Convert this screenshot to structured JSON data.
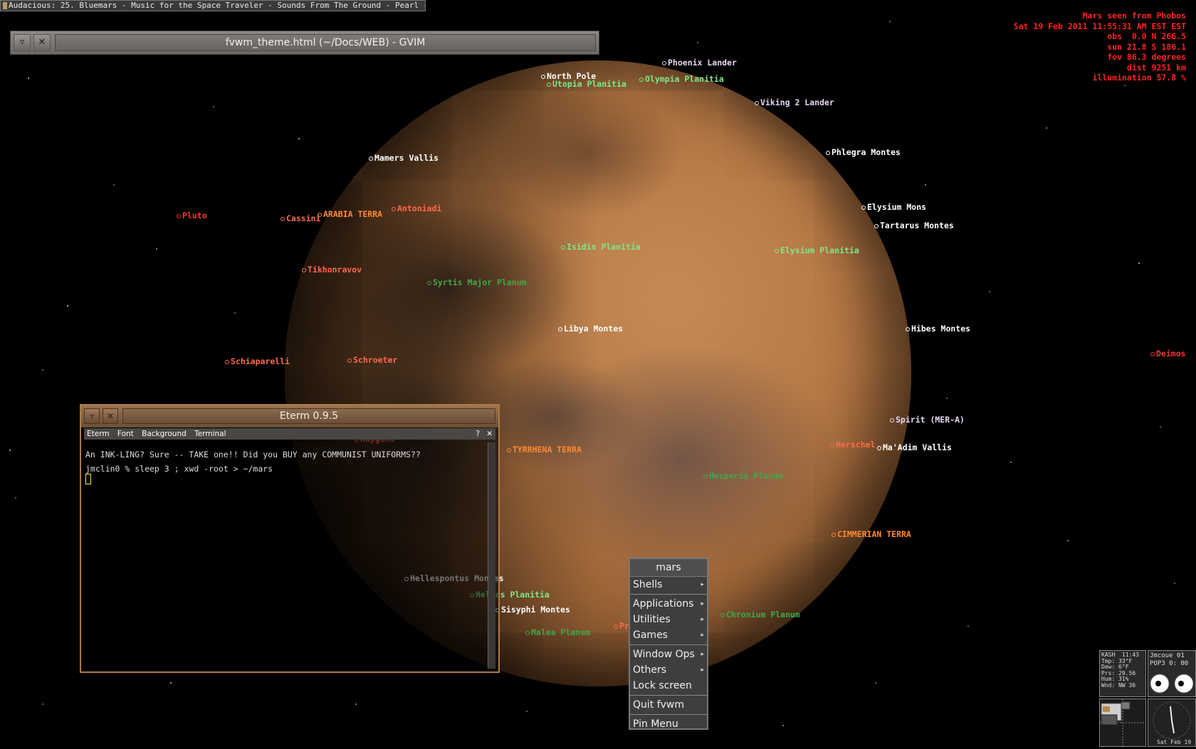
{
  "audacious_bar": {
    "text": "Audacious: 25. Bluemars - Music for the Space Traveler - Sounds From The Ground - Pearl - Audacio"
  },
  "gvim": {
    "title": "fvwm_theme.html (~/Docs/WEB) - GVIM"
  },
  "info": {
    "line1": "Mars seen from Phobos",
    "line2": "Sat 19 Feb 2011 11:55:31 AM EST EST",
    "line3": "obs  0.0 N 266.5",
    "line4": "sun 21.8 S 186.1",
    "line5": "fov 86.3 degrees",
    "line6": "dist 9251 km",
    "line7": "illumination 57.8 %"
  },
  "labels": [
    {
      "text": "Phoenix Lander",
      "color": "#e6d6f2"
    },
    {
      "text": "North Pole",
      "color": "#ffffff"
    },
    {
      "text": "Olympia Planitia",
      "color": "#7fe88a"
    },
    {
      "text": "Utopia Planitia",
      "color": "#7fe88a"
    },
    {
      "text": "Viking 2 Lander",
      "color": "#e6d6f2"
    },
    {
      "text": "Mamers Vallis",
      "color": "#ffffff"
    },
    {
      "text": "Phlegra Montes",
      "color": "#ffffff"
    },
    {
      "text": "Pluto",
      "color": "#ff3030"
    },
    {
      "text": "Cassini",
      "color": "#ff6a4a"
    },
    {
      "text": "ARABIA TERRA",
      "color": "#ff8a30"
    },
    {
      "text": "Antoniadi",
      "color": "#ff6a4a"
    },
    {
      "text": "Elysium Mons",
      "color": "#ffffff"
    },
    {
      "text": "Tartarus Montes",
      "color": "#ffffff"
    },
    {
      "text": "Isidis Planitia",
      "color": "#7fe88a"
    },
    {
      "text": "Elysium Planitia",
      "color": "#7fe88a"
    },
    {
      "text": "Tikhonravov",
      "color": "#ff6a4a"
    },
    {
      "text": "Syrtis Major Planum",
      "color": "#3fa84a"
    },
    {
      "text": "Libya Montes",
      "color": "#ffffff"
    },
    {
      "text": "Hibes Montes",
      "color": "#ffffff"
    },
    {
      "text": "Deimos",
      "color": "#ff3030"
    },
    {
      "text": "Schiaparelli",
      "color": "#ff6a4a"
    },
    {
      "text": "Schroeter",
      "color": "#ff6a4a"
    },
    {
      "text": "Spirit (MER-A)",
      "color": "#e6d6f2"
    },
    {
      "text": "Huygens",
      "color": "#ff6a4a"
    },
    {
      "text": "TYRRHENA TERRA",
      "color": "#ff8a30"
    },
    {
      "text": "Herschel",
      "color": "#ff6a4a"
    },
    {
      "text": "Ma'Adim Vallis",
      "color": "#ffffff"
    },
    {
      "text": "Hesperia Planum",
      "color": "#3fa84a"
    },
    {
      "text": "CIMMERIAN TERRA",
      "color": "#ff8a30"
    },
    {
      "text": "Hellespontus Montes",
      "color": "#ffffff"
    },
    {
      "text": "Hellas Planitia",
      "color": "#7fe88a"
    },
    {
      "text": "Sisyphi Montes",
      "color": "#ffffff"
    },
    {
      "text": "Chronium Planum",
      "color": "#3fa84a"
    },
    {
      "text": "Malea Planum",
      "color": "#3fa84a"
    },
    {
      "text": "Pr",
      "color": "#ff6a4a"
    }
  ],
  "eterm": {
    "title": "Eterm 0.9.5",
    "menu": [
      "Eterm",
      "Font",
      "Background",
      "Terminal"
    ],
    "help": "?",
    "close": "✕",
    "line1": "An INK-LING?  Sure -- TAKE one!!  Did you BUY any COMMUNIST UNIFORMS??",
    "line2": "jmclin0 % sleep 3 ; xwd -root > ~/mars"
  },
  "fvwm_menu": {
    "title": "mars",
    "items": [
      "Shells",
      "Applications",
      "Utilities",
      "Games",
      "Window Ops",
      "Others",
      "Lock screen",
      "Quit fvwm",
      "Pin Menu"
    ]
  },
  "dock": {
    "weather": "KASH  11:43\nTmp: 33°F\nDew: 6°F\nPrs: 29.56\nHum: 31%\nWnd: NW 36",
    "mail": "Jmcoue 01\nPOP3 0: 00",
    "date": "Sat Feb 19"
  }
}
